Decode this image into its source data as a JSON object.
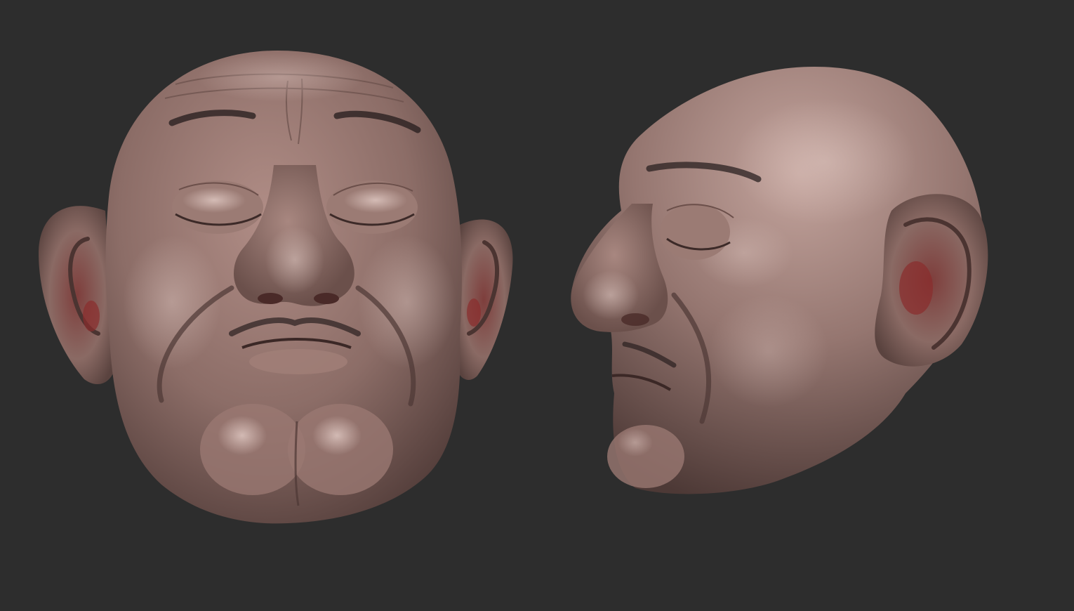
{
  "scene": {
    "background_color": "#2d2d2d",
    "skin_base_color": "#8d6f69",
    "skin_light_color": "#b99892",
    "skin_dark_color": "#4e3936",
    "inner_ear_color": "#7a3a38",
    "brow_color": "#2a2020"
  },
  "subjects": [
    {
      "name": "sculpted-head-front-view",
      "icon": "bald-head-front"
    },
    {
      "name": "sculpted-head-side-view",
      "icon": "bald-head-profile"
    }
  ]
}
